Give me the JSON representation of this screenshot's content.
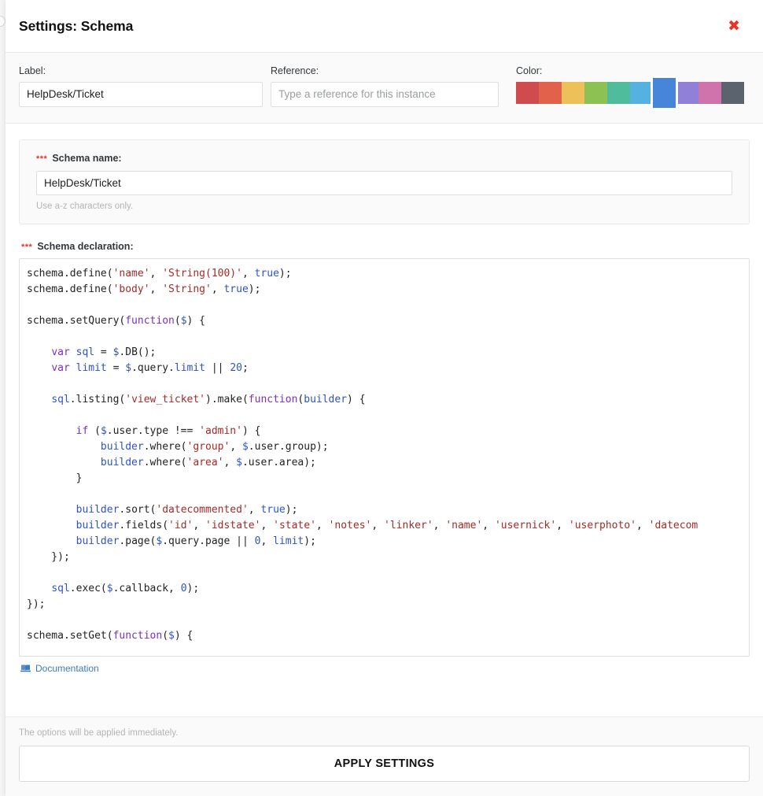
{
  "window": {
    "title": "Settings: Schema",
    "close_icon": "close-icon",
    "close_glyph": "✖"
  },
  "top_bar": {
    "label_caption": "Label:",
    "label_value": "HelpDesk/Ticket",
    "reference_caption": "Reference:",
    "reference_value": "",
    "reference_placeholder": "Type a reference for this instance",
    "color_caption": "Color:",
    "colors": [
      {
        "name": "red",
        "hex": "#cf4b4e",
        "selected": false
      },
      {
        "name": "orange-red",
        "hex": "#e2614a",
        "selected": false
      },
      {
        "name": "yellow",
        "hex": "#eec05a",
        "selected": false
      },
      {
        "name": "green",
        "hex": "#8dc153",
        "selected": false
      },
      {
        "name": "teal",
        "hex": "#4fbc9b",
        "selected": false
      },
      {
        "name": "light-blue",
        "hex": "#55b2e0",
        "selected": false
      },
      {
        "name": "blue",
        "hex": "#4785db",
        "selected": true
      },
      {
        "name": "purple",
        "hex": "#9180d8",
        "selected": false
      },
      {
        "name": "pink",
        "hex": "#d073ad",
        "selected": false
      },
      {
        "name": "slate",
        "hex": "#5b636e",
        "selected": false
      }
    ]
  },
  "schema_name": {
    "required_marker": "***",
    "caption": "Schema name:",
    "value": "HelpDesk/Ticket",
    "hint": "Use a-z characters only."
  },
  "schema_declaration": {
    "required_marker": "***",
    "caption": "Schema declaration:",
    "code_lines": [
      "schema.define('name', 'String(100)', true);",
      "schema.define('body', 'String', true);",
      "",
      "schema.setQuery(function($) {",
      "",
      "    var sql = $.DB();",
      "    var limit = $.query.limit || 20;",
      "",
      "    sql.listing('view_ticket').make(function(builder) {",
      "",
      "        if ($.user.type !== 'admin') {",
      "            builder.where('group', $.user.group);",
      "            builder.where('area', $.user.area);",
      "        }",
      "",
      "        builder.sort('datecommented', true);",
      "        builder.fields('id', 'idstate', 'state', 'notes', 'linker', 'name', 'usernick', 'userphoto', 'datecom",
      "        builder.page($.query.page || 0, limit);",
      "    });",
      "",
      "    sql.exec($.callback, 0);",
      "});",
      "",
      "schema.setGet(function($) {"
    ]
  },
  "documentation": {
    "icon": "book-icon",
    "label": "Documentation"
  },
  "footer": {
    "note": "The options will be applied immediately.",
    "apply_label": "APPLY SETTINGS"
  },
  "theme": {
    "accent_blue": "#4785db",
    "danger_red": "#e8352a",
    "link_blue": "#3c7bbf",
    "code_string": "#a52a2a",
    "code_keyword": "#7b2fbe",
    "code_variable": "#2d53c8"
  }
}
